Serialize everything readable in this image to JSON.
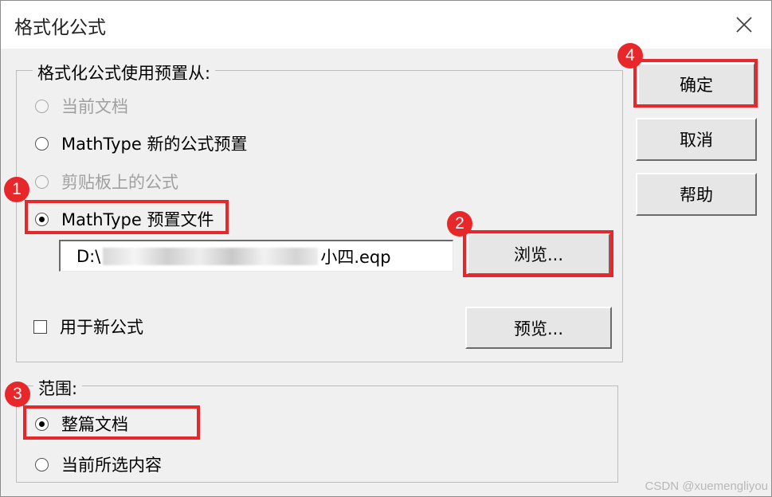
{
  "window": {
    "title": "格式化公式"
  },
  "group_source": {
    "legend": "格式化公式使用预置从:",
    "options": [
      {
        "label": "当前文档",
        "selected": false,
        "disabled": true
      },
      {
        "label": "MathType 新的公式预置",
        "selected": false,
        "disabled": false
      },
      {
        "label": "剪贴板上的公式",
        "selected": false,
        "disabled": true
      },
      {
        "label": "MathType 预置文件",
        "selected": true,
        "disabled": false
      }
    ],
    "file_path": {
      "prefix": "D:\\",
      "suffix": "小四.eqp"
    },
    "browse_label": "浏览...",
    "use_for_new_label": "用于新公式",
    "use_for_new_checked": false,
    "preview_label": "预览..."
  },
  "group_scope": {
    "legend": "范围:",
    "options": [
      {
        "label": "整篇文档",
        "selected": true
      },
      {
        "label": "当前所选内容",
        "selected": false
      }
    ]
  },
  "buttons": {
    "ok": "确定",
    "cancel": "取消",
    "help": "帮助"
  },
  "annotations": {
    "b1": "1",
    "b2": "2",
    "b3": "3",
    "b4": "4",
    "color": "#e8272a"
  },
  "watermark": "CSDN @xuemengliyou"
}
